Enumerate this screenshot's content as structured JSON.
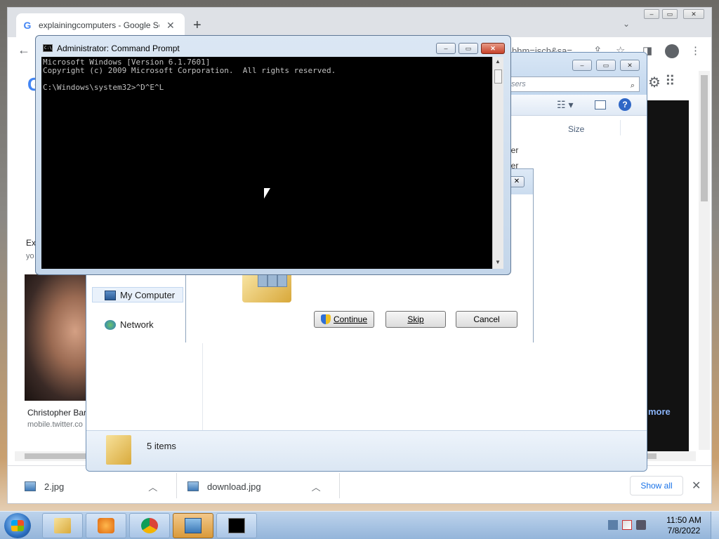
{
  "chrome": {
    "tab_title": "explainingcomputers - Google Search",
    "tab_icon": "G",
    "tab_close": "✕",
    "new_tab": "+",
    "url_fragment": "bhm=isch&sa=",
    "results": {
      "r1_title": "Ex",
      "r1_source": "yo",
      "person_name": "Christopher Bar",
      "person_source": "mobile.twitter.co",
      "more": "more"
    },
    "downloads": [
      {
        "name": "2.jpg"
      },
      {
        "name": "download.jpg"
      }
    ],
    "show_all": "Show all",
    "download_close": "✕"
  },
  "explorer": {
    "search_placeholder": "sers",
    "column_size": "Size",
    "frag1": "der",
    "frag2": "der",
    "nav_my_computer": "My Computer",
    "nav_network": "Network",
    "status": "5 items"
  },
  "dialog": {
    "close": "✕",
    "continue": "Continue",
    "skip": "Skip",
    "cancel": "Cancel"
  },
  "cmd": {
    "title": "Administrator: Command Prompt",
    "icon_text": "C:\\",
    "lines": "Microsoft Windows [Version 6.1.7601]\nCopyright (c) 2009 Microsoft Corporation.  All rights reserved.\n\nC:\\Windows\\system32>^D^E^L"
  },
  "taskbar": {
    "time": "11:50 AM",
    "date": "7/8/2022"
  },
  "colors": {
    "console_bg": "#000000",
    "console_text": "#c0c0c0",
    "link": "#1a73e8"
  }
}
